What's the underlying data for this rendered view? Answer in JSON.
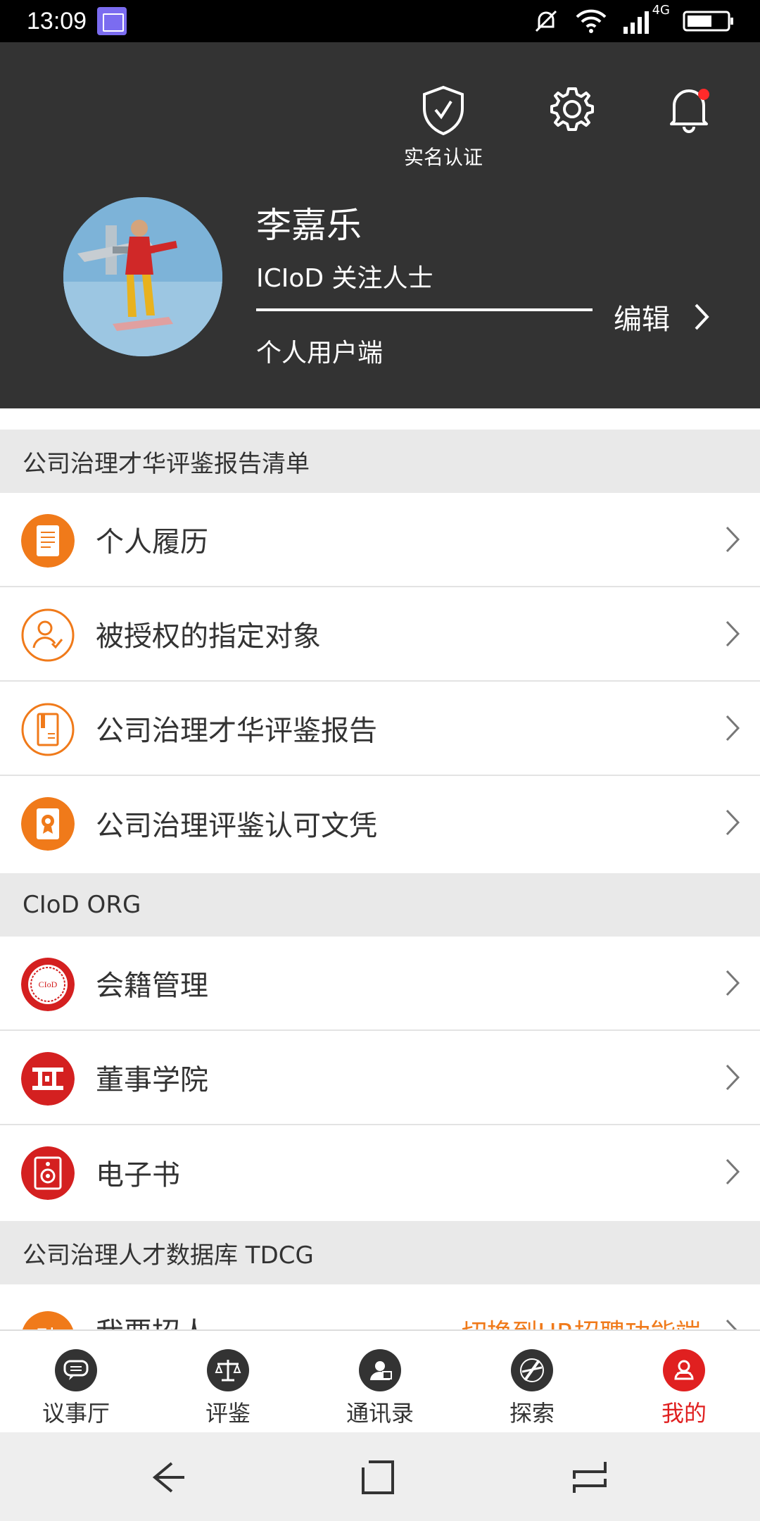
{
  "status_bar": {
    "time": "13:09",
    "network": "4G"
  },
  "header": {
    "verify_label": "实名认证",
    "username": "李嘉乐",
    "role": "ICIoD 关注人士",
    "client_type": "个人用户端",
    "edit_label": "编辑",
    "notification_dot_color": "#ff2a2a"
  },
  "sections": [
    {
      "title": "公司治理才华评鉴报告清单",
      "items": [
        {
          "label": "个人履历",
          "icon": "resume-icon"
        },
        {
          "label": "被授权的指定对象",
          "icon": "authorized-person-icon"
        },
        {
          "label": "公司治理才华评鉴报告",
          "icon": "report-icon"
        },
        {
          "label": "公司治理评鉴认可文凭",
          "icon": "diploma-icon"
        }
      ]
    },
    {
      "title": "CIoD ORG",
      "items": [
        {
          "label": "会籍管理",
          "icon": "ciod-seal-icon"
        },
        {
          "label": "董事学院",
          "icon": "academy-icon"
        },
        {
          "label": "电子书",
          "icon": "ebook-icon"
        }
      ]
    },
    {
      "title": "公司治理人才数据库 TDCG",
      "items": [
        {
          "label": "我要招人",
          "icon": "hire-icon",
          "extra": "切换到HR招聘功能端"
        }
      ]
    }
  ],
  "bottom_nav": [
    {
      "label": "议事厅",
      "icon": "chat-icon",
      "active": false
    },
    {
      "label": "评鉴",
      "icon": "scale-icon",
      "active": false
    },
    {
      "label": "通讯录",
      "icon": "contacts-icon",
      "active": false
    },
    {
      "label": "探索",
      "icon": "explore-icon",
      "active": false
    },
    {
      "label": "我的",
      "icon": "profile-icon",
      "active": true
    }
  ],
  "colors": {
    "header_bg": "#333333",
    "accent_orange": "#f07a1a",
    "accent_red": "#e02020"
  }
}
